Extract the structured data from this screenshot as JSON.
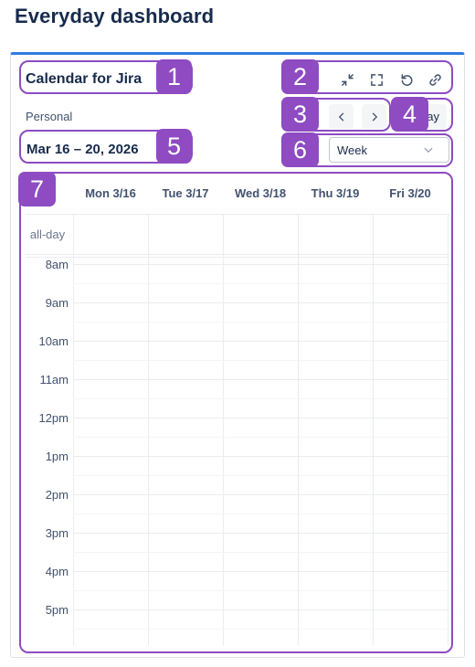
{
  "dashboard": {
    "title": "Everyday dashboard"
  },
  "gadget": {
    "title": "Calendar for Jira",
    "calendar_name": "Personal",
    "date_range": "Mar 16 – 20, 2026",
    "view_select": {
      "selected": "Week"
    },
    "today_label": "ay",
    "icons": [
      "minimize-icon",
      "fullscreen-icon",
      "refresh-icon",
      "link-icon",
      "chevron-left-icon",
      "chevron-right-icon",
      "chevron-down-icon"
    ]
  },
  "calendar": {
    "days": [
      "Mon 3/16",
      "Tue 3/17",
      "Wed 3/18",
      "Thu 3/19",
      "Fri 3/20"
    ],
    "allday_label": "all-day",
    "hours": [
      "8am",
      "9am",
      "10am",
      "11am",
      "12pm",
      "1pm",
      "2pm",
      "3pm",
      "4pm",
      "5pm"
    ]
  },
  "annotations": {
    "numbers": [
      "1",
      "2",
      "3",
      "4",
      "5",
      "6",
      "7"
    ],
    "color": "#8e4bc2"
  },
  "colors": {
    "accent_bar": "#2e7de1",
    "text_primary": "#172b4d",
    "text_secondary": "#42526e"
  }
}
